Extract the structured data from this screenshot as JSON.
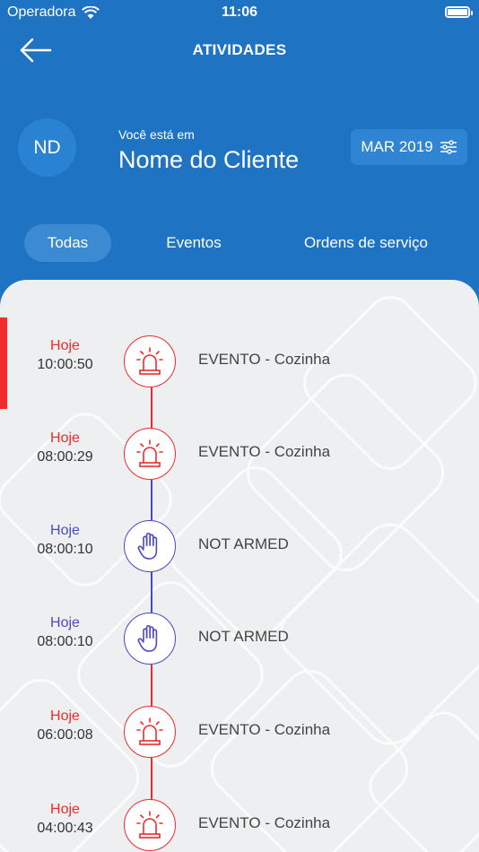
{
  "status_bar": {
    "carrier": "Operadora",
    "time": "11:06"
  },
  "nav": {
    "title": "ATIVIDADES"
  },
  "header": {
    "avatar_initials": "ND",
    "location_label": "Você está em",
    "client_name": "Nome do Cliente",
    "period_label": "MAR 2019"
  },
  "tabs": [
    {
      "label": "Todas",
      "active": true
    },
    {
      "label": "Eventos",
      "active": false
    },
    {
      "label": "Ordens de serviço",
      "active": false
    }
  ],
  "colors": {
    "primary": "#1f73c3",
    "alarm": "#f02a2a",
    "armed": "#4b48c5",
    "active_marker": "#f22c2c"
  },
  "activities": [
    {
      "day": "Hoje",
      "time": "10:00:50",
      "title": "EVENTO - Cozinha",
      "kind": "alarm",
      "icon": "siren-icon"
    },
    {
      "day": "Hoje",
      "time": "08:00:29",
      "title": "EVENTO - Cozinha",
      "kind": "alarm",
      "icon": "siren-icon"
    },
    {
      "day": "Hoje",
      "time": "08:00:10",
      "title": "NOT ARMED",
      "kind": "armed",
      "icon": "hand-icon"
    },
    {
      "day": "Hoje",
      "time": "08:00:10",
      "title": "NOT ARMED",
      "kind": "armed",
      "icon": "hand-icon"
    },
    {
      "day": "Hoje",
      "time": "06:00:08",
      "title": "EVENTO - Cozinha",
      "kind": "alarm",
      "icon": "siren-icon"
    },
    {
      "day": "Hoje",
      "time": "04:00:43",
      "title": "EVENTO - Cozinha",
      "kind": "alarm",
      "icon": "siren-icon"
    }
  ]
}
